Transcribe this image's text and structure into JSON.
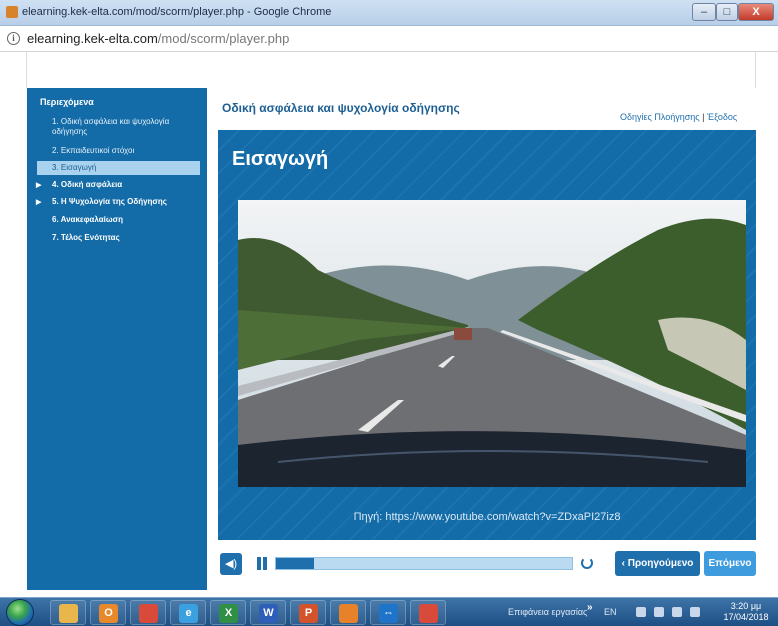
{
  "window": {
    "title": "elearning.kek-elta.com/mod/scorm/player.php - Google Chrome",
    "controls": {
      "minimize": "–",
      "maximize": "□",
      "close": "X"
    }
  },
  "address": {
    "host": "elearning.kek-elta.com",
    "path": "/mod/scorm/player.php"
  },
  "course": {
    "title": "Οδική ασφάλεια και ψυχολογία οδήγησης",
    "links": {
      "help": "Οδηγίες Πλοήγησης",
      "separator": "|",
      "exit": "Έξοδος"
    }
  },
  "sidebar": {
    "heading": "Περιεχόμενα",
    "items": [
      {
        "label": "1. Οδική ασφάλεια και ψυχολογία οδήγησης",
        "state": "normal",
        "expandable": false
      },
      {
        "label": "2. Εκπαιδευτικοί στόχοι",
        "state": "normal",
        "expandable": false
      },
      {
        "label": "3. Εισαγωγή",
        "state": "active",
        "expandable": false
      },
      {
        "label": "4. Οδική ασφάλεια",
        "state": "bold",
        "expandable": true
      },
      {
        "label": "5. Η Ψυχολογία της Οδήγησης",
        "state": "bold",
        "expandable": true
      },
      {
        "label": "6. Ανακεφαλαίωση",
        "state": "bold",
        "expandable": false
      },
      {
        "label": "7. Τέλος Ενότητας",
        "state": "bold",
        "expandable": false
      }
    ]
  },
  "slide": {
    "title": "Εισαγωγή",
    "source": "Πηγή: https://www.youtube.com/watch?v=ZDxaPI27iz8"
  },
  "player": {
    "progress": 0.13
  },
  "nav": {
    "prev": "‹ Προηγούμενο",
    "next": "Επόμενο"
  },
  "taskbar": {
    "apps": [
      {
        "name": "explorer",
        "glyph": "",
        "color": "#e8b64a"
      },
      {
        "name": "outlook",
        "glyph": "O",
        "color": "#e7882a"
      },
      {
        "name": "chrome",
        "glyph": "",
        "color": "#d84a3a"
      },
      {
        "name": "ie",
        "glyph": "e",
        "color": "#3aa0e0"
      },
      {
        "name": "excel",
        "glyph": "X",
        "color": "#2f8f45"
      },
      {
        "name": "word",
        "glyph": "W",
        "color": "#2d5fb8"
      },
      {
        "name": "powerpoint",
        "glyph": "P",
        "color": "#d3532c"
      },
      {
        "name": "firefox",
        "glyph": "",
        "color": "#e8822a"
      },
      {
        "name": "teamviewer",
        "glyph": "⇔",
        "color": "#1d74c9"
      },
      {
        "name": "chrome2",
        "glyph": "",
        "color": "#d84a3a"
      }
    ],
    "tray_label": "Επιφάνεια εργασίας",
    "tray_chevron": "»",
    "lang": "EN",
    "time": "3:20 μμ",
    "date": "17/04/2018"
  }
}
